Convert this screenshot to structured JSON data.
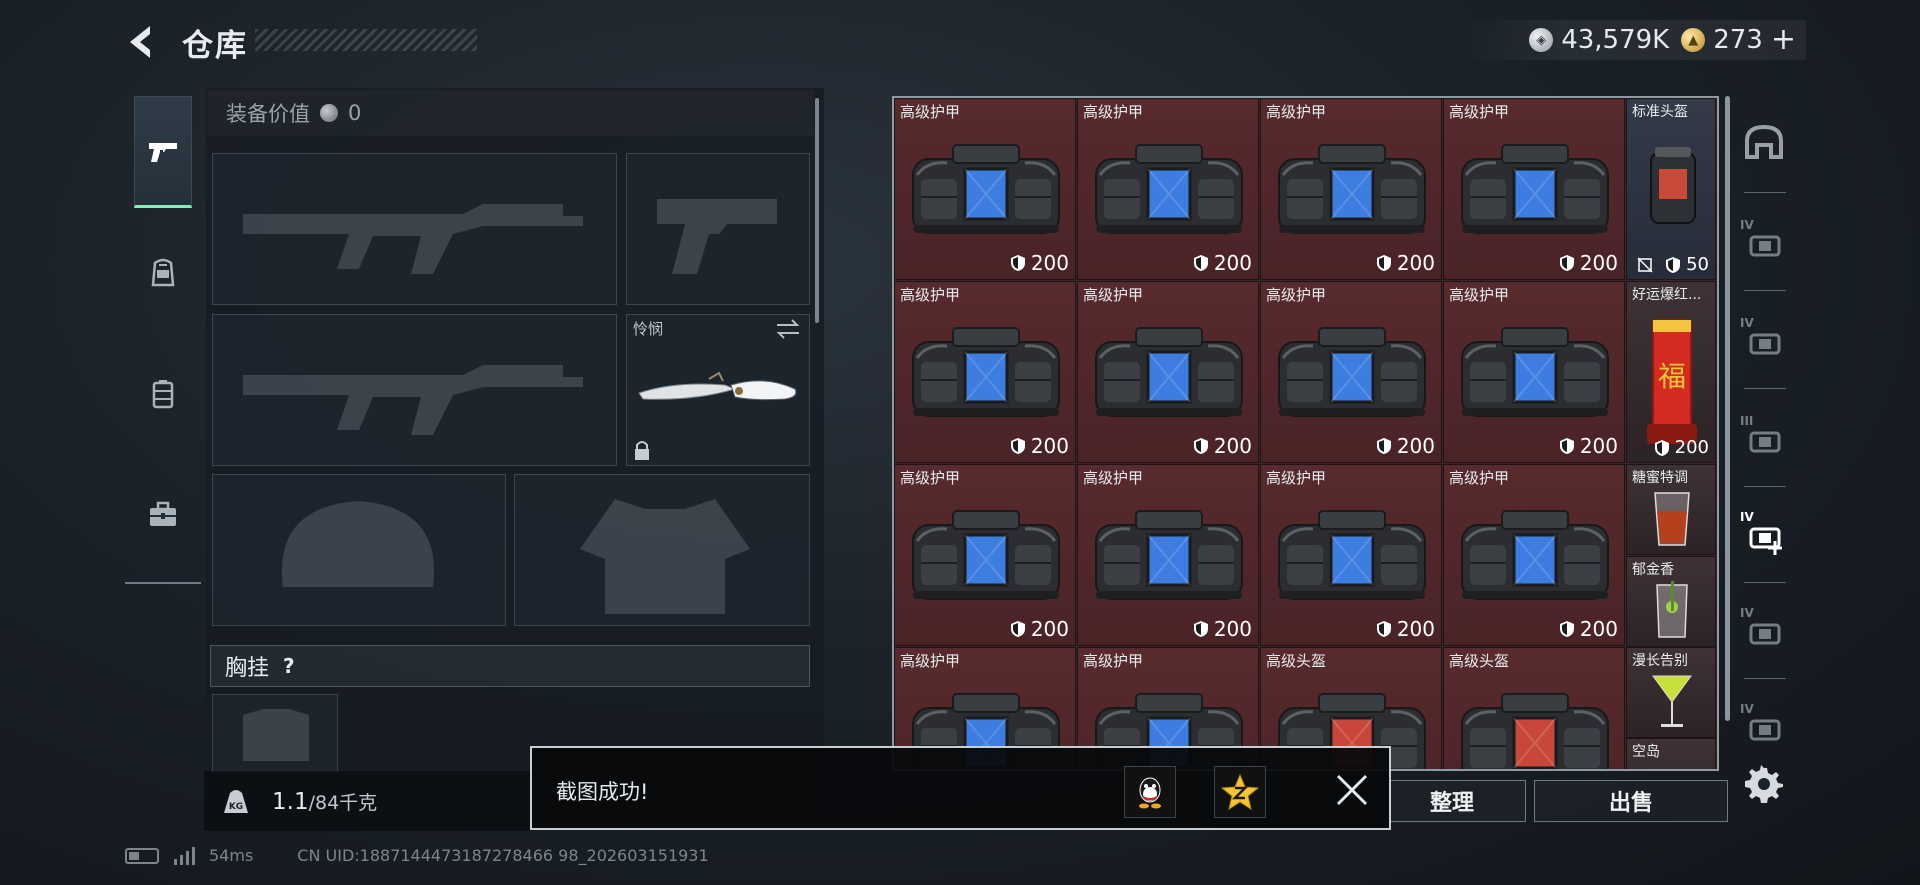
{
  "header": {
    "title": "仓库",
    "currencies": [
      {
        "icon": "silver-coin-icon",
        "value": "43,579K"
      },
      {
        "icon": "gold-coin-icon",
        "value": "273"
      }
    ],
    "add_label": "+"
  },
  "categories": [
    {
      "name": "weapon",
      "icon": "pistol-icon",
      "active": true
    },
    {
      "name": "backpack",
      "icon": "backpack-icon",
      "active": false
    },
    {
      "name": "container",
      "icon": "container-icon",
      "active": false
    },
    {
      "name": "toolbox",
      "icon": "toolbox-icon",
      "active": false
    }
  ],
  "equipment": {
    "value_label": "装备价值",
    "value": "0",
    "melee_label": "怜悯",
    "vest_label": "胸挂",
    "vest_help": "?"
  },
  "weight": {
    "current": "1.1",
    "capacity": "/84千克"
  },
  "status": {
    "ping": "54ms",
    "uid": "CN UID:1887144473187278466 98_202603151931"
  },
  "inventory": {
    "rows": [
      [
        {
          "name": "高级护甲",
          "durability": "200"
        },
        {
          "name": "高级护甲",
          "durability": "200"
        },
        {
          "name": "高级护甲",
          "durability": "200"
        },
        {
          "name": "高级护甲",
          "durability": "200"
        }
      ],
      [
        {
          "name": "高级护甲",
          "durability": "200"
        },
        {
          "name": "高级护甲",
          "durability": "200"
        },
        {
          "name": "高级护甲",
          "durability": "200"
        },
        {
          "name": "高级护甲",
          "durability": "200"
        }
      ],
      [
        {
          "name": "高级护甲",
          "durability": "200"
        },
        {
          "name": "高级护甲",
          "durability": "200"
        },
        {
          "name": "高级护甲",
          "durability": "200"
        },
        {
          "name": "高级护甲",
          "durability": "200"
        }
      ],
      [
        {
          "name": "高级护甲",
          "durability": ""
        },
        {
          "name": "高级护甲",
          "durability": ""
        },
        {
          "name": "高级头盔",
          "durability": ""
        },
        {
          "name": "高级头盔",
          "durability": ""
        }
      ]
    ],
    "side_items": [
      {
        "name": "标准头盔",
        "durability": "50"
      },
      {
        "name": "好运爆红...",
        "durability": "200"
      },
      {
        "name": "糖蜜特调"
      },
      {
        "name": "郁金香"
      },
      {
        "name": "漫长告别"
      },
      {
        "name": "空岛"
      }
    ]
  },
  "filters": [
    {
      "icon": "helmet-filter-icon",
      "tier": ""
    },
    {
      "icon": "armor-iv-icon",
      "tier": "IV"
    },
    {
      "icon": "armor-iv-alt-icon",
      "tier": "IV"
    },
    {
      "icon": "armor-iii-icon",
      "tier": "III"
    },
    {
      "icon": "armor-iv-plus-icon",
      "tier": "IV"
    },
    {
      "icon": "armor-iv-bag-icon",
      "tier": "IV"
    },
    {
      "icon": "armor-iv-bottom-icon",
      "tier": "IV"
    }
  ],
  "actions": {
    "sort_label": "整理",
    "sell_label": "出售"
  },
  "toast": {
    "message": "截图成功!",
    "share_qq": "qq-share-icon",
    "share_qzone": "qzone-share-icon"
  },
  "colors": {
    "accent_green": "#7ff0b6",
    "inventory_bg": "#582a2d",
    "armor_blue": "#3d7de0"
  }
}
